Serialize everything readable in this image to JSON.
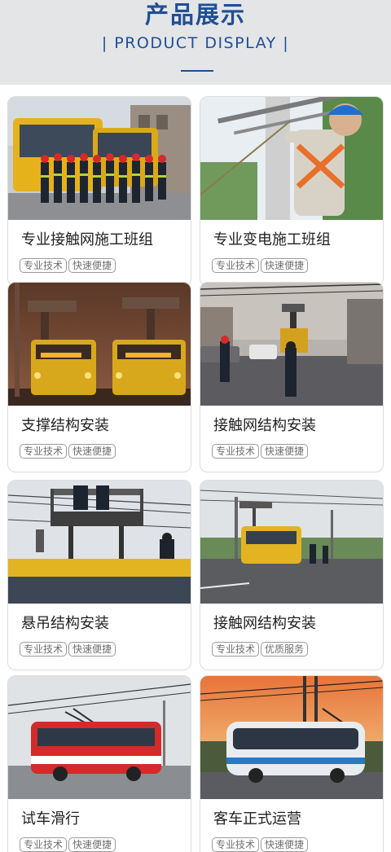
{
  "header": {
    "title": "产品展示",
    "subtitle": "| PRODUCT DISPLAY |"
  },
  "products": [
    {
      "title": "专业接触网施工班组",
      "tags": [
        "专业技术",
        "快速便捷"
      ]
    },
    {
      "title": "专业变电施工班组",
      "tags": [
        "专业技术",
        "快速便捷"
      ]
    },
    {
      "title": "支撑结构安装",
      "tags": [
        "专业技术",
        "快速便捷"
      ]
    },
    {
      "title": "接触网结构安装",
      "tags": [
        "专业技术",
        "快速便捷"
      ]
    },
    {
      "title": "悬吊结构安装",
      "tags": [
        "专业技术",
        "快速便捷"
      ]
    },
    {
      "title": "接触网结构安装",
      "tags": [
        "专业技术",
        "优质服务"
      ]
    },
    {
      "title": "试车滑行",
      "tags": [
        "专业技术",
        "快速便捷"
      ]
    },
    {
      "title": "客车正式运营",
      "tags": [
        "专业技术",
        "快速便捷"
      ]
    }
  ],
  "colors": {
    "accent": "#1f4f95",
    "bus_yellow": "#e9b21a",
    "bus_red": "#d42a2a"
  }
}
